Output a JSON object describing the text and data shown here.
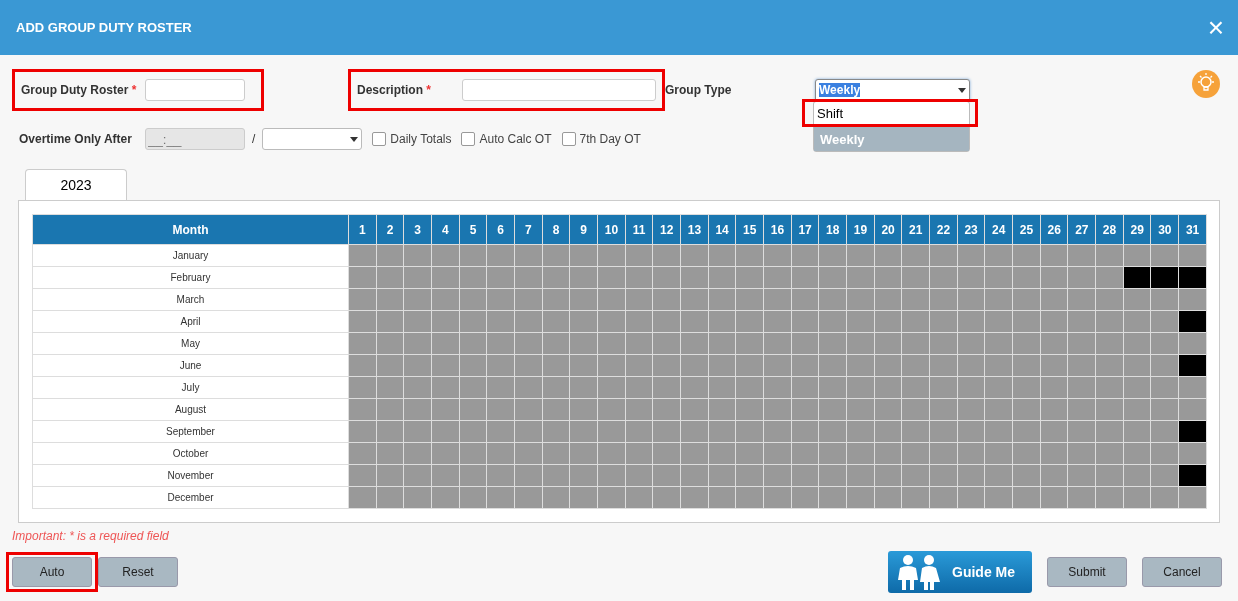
{
  "dialog": {
    "title": "ADD GROUP DUTY ROSTER",
    "close_icon": "×"
  },
  "fields": {
    "group_duty_roster": {
      "label": "Group Duty Roster",
      "required_mark": "*",
      "highlighted": true
    },
    "description": {
      "label": "Description",
      "required_mark": "*",
      "highlighted": true
    },
    "group_type": {
      "label": "Group Type",
      "value": "Weekly",
      "expanded": true,
      "options": [
        {
          "label": "Shift",
          "selected": false,
          "highlighted": true
        },
        {
          "label": "Weekly",
          "selected": true,
          "highlighted": false
        }
      ]
    },
    "overtime": {
      "label": "Overtime Only After",
      "time_placeholder": "__:__",
      "separator": "/"
    },
    "checkboxes": [
      {
        "label": "Daily Totals",
        "checked": false
      },
      {
        "label": "Auto Calc OT",
        "checked": false
      },
      {
        "label": "7th Day OT",
        "checked": false
      }
    ]
  },
  "tabs": [
    {
      "label": "2023",
      "selected": true
    }
  ],
  "roster": {
    "month_header": "Month",
    "days": [
      "1",
      "2",
      "3",
      "4",
      "5",
      "6",
      "7",
      "8",
      "9",
      "10",
      "11",
      "12",
      "13",
      "14",
      "15",
      "16",
      "17",
      "18",
      "19",
      "20",
      "21",
      "22",
      "23",
      "24",
      "25",
      "26",
      "27",
      "28",
      "29",
      "30",
      "31"
    ],
    "months": [
      {
        "name": "January",
        "blocked": [
          false,
          false,
          false,
          false,
          false,
          false,
          false,
          false,
          false,
          false,
          false,
          false,
          false,
          false,
          false,
          false,
          false,
          false,
          false,
          false,
          false,
          false,
          false,
          false,
          false,
          false,
          false,
          false,
          false,
          false,
          false
        ]
      },
      {
        "name": "February",
        "blocked": [
          false,
          false,
          false,
          false,
          false,
          false,
          false,
          false,
          false,
          false,
          false,
          false,
          false,
          false,
          false,
          false,
          false,
          false,
          false,
          false,
          false,
          false,
          false,
          false,
          false,
          false,
          false,
          false,
          true,
          true,
          true
        ]
      },
      {
        "name": "March",
        "blocked": [
          false,
          false,
          false,
          false,
          false,
          false,
          false,
          false,
          false,
          false,
          false,
          false,
          false,
          false,
          false,
          false,
          false,
          false,
          false,
          false,
          false,
          false,
          false,
          false,
          false,
          false,
          false,
          false,
          false,
          false,
          false
        ]
      },
      {
        "name": "April",
        "blocked": [
          false,
          false,
          false,
          false,
          false,
          false,
          false,
          false,
          false,
          false,
          false,
          false,
          false,
          false,
          false,
          false,
          false,
          false,
          false,
          false,
          false,
          false,
          false,
          false,
          false,
          false,
          false,
          false,
          false,
          false,
          true
        ]
      },
      {
        "name": "May",
        "blocked": [
          false,
          false,
          false,
          false,
          false,
          false,
          false,
          false,
          false,
          false,
          false,
          false,
          false,
          false,
          false,
          false,
          false,
          false,
          false,
          false,
          false,
          false,
          false,
          false,
          false,
          false,
          false,
          false,
          false,
          false,
          false
        ]
      },
      {
        "name": "June",
        "blocked": [
          false,
          false,
          false,
          false,
          false,
          false,
          false,
          false,
          false,
          false,
          false,
          false,
          false,
          false,
          false,
          false,
          false,
          false,
          false,
          false,
          false,
          false,
          false,
          false,
          false,
          false,
          false,
          false,
          false,
          false,
          true
        ]
      },
      {
        "name": "July",
        "blocked": [
          false,
          false,
          false,
          false,
          false,
          false,
          false,
          false,
          false,
          false,
          false,
          false,
          false,
          false,
          false,
          false,
          false,
          false,
          false,
          false,
          false,
          false,
          false,
          false,
          false,
          false,
          false,
          false,
          false,
          false,
          false
        ]
      },
      {
        "name": "August",
        "blocked": [
          false,
          false,
          false,
          false,
          false,
          false,
          false,
          false,
          false,
          false,
          false,
          false,
          false,
          false,
          false,
          false,
          false,
          false,
          false,
          false,
          false,
          false,
          false,
          false,
          false,
          false,
          false,
          false,
          false,
          false,
          false
        ]
      },
      {
        "name": "September",
        "blocked": [
          false,
          false,
          false,
          false,
          false,
          false,
          false,
          false,
          false,
          false,
          false,
          false,
          false,
          false,
          false,
          false,
          false,
          false,
          false,
          false,
          false,
          false,
          false,
          false,
          false,
          false,
          false,
          false,
          false,
          false,
          true
        ]
      },
      {
        "name": "October",
        "blocked": [
          false,
          false,
          false,
          false,
          false,
          false,
          false,
          false,
          false,
          false,
          false,
          false,
          false,
          false,
          false,
          false,
          false,
          false,
          false,
          false,
          false,
          false,
          false,
          false,
          false,
          false,
          false,
          false,
          false,
          false,
          false
        ]
      },
      {
        "name": "November",
        "blocked": [
          false,
          false,
          false,
          false,
          false,
          false,
          false,
          false,
          false,
          false,
          false,
          false,
          false,
          false,
          false,
          false,
          false,
          false,
          false,
          false,
          false,
          false,
          false,
          false,
          false,
          false,
          false,
          false,
          false,
          false,
          true
        ]
      },
      {
        "name": "December",
        "blocked": [
          false,
          false,
          false,
          false,
          false,
          false,
          false,
          false,
          false,
          false,
          false,
          false,
          false,
          false,
          false,
          false,
          false,
          false,
          false,
          false,
          false,
          false,
          false,
          false,
          false,
          false,
          false,
          false,
          false,
          false,
          false
        ]
      }
    ]
  },
  "note": "Important: * is a required field",
  "left_buttons": [
    {
      "label": "Auto",
      "highlighted": true
    },
    {
      "label": "Reset",
      "highlighted": false
    }
  ],
  "right_buttons": [
    {
      "label": "Guide Me",
      "kind": "guide"
    },
    {
      "label": "Submit",
      "kind": "plain"
    },
    {
      "label": "Cancel",
      "kind": "plain"
    }
  ]
}
